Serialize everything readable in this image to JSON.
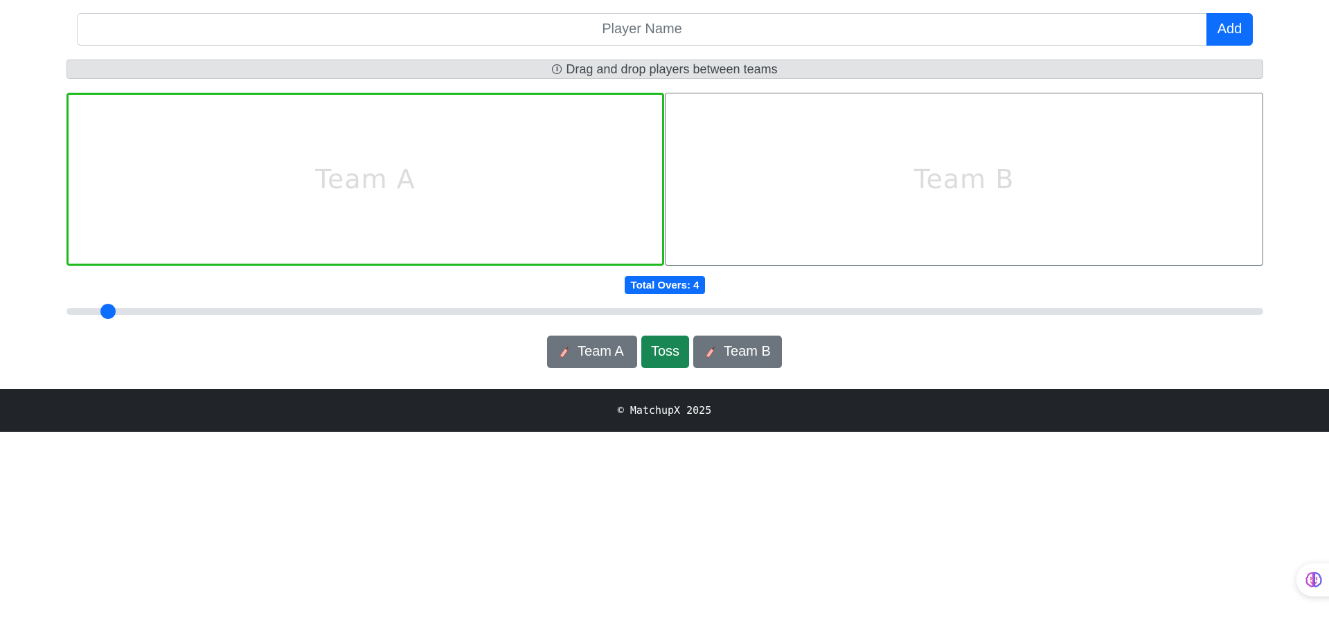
{
  "player_form": {
    "placeholder": "Player Name",
    "value": "",
    "add_label": "Add"
  },
  "info_banner": {
    "icon": "info-circle-icon",
    "text": "Drag and drop players between teams"
  },
  "teams": {
    "team_a": {
      "title": "Team A",
      "highlighted": true,
      "highlight_color": "#1dbb1d"
    },
    "team_b": {
      "title": "Team B",
      "highlighted": false
    }
  },
  "overs": {
    "badge_label": "Total Overs: 4",
    "value": 4,
    "slider_fraction": 0.035
  },
  "actions": {
    "team_a_label": "Team A",
    "team_a_icon": "cricket-bat-icon",
    "toss_label": "Toss",
    "team_b_label": "Team B",
    "team_b_icon": "cricket-bat-icon"
  },
  "footer": {
    "text": "© MatchupX 2025"
  },
  "floating_widget": {
    "icon": "brain-icon"
  },
  "colors": {
    "primary": "#0d6efd",
    "success": "#198754",
    "secondary": "#6c757d",
    "footer_bg": "#212529"
  }
}
